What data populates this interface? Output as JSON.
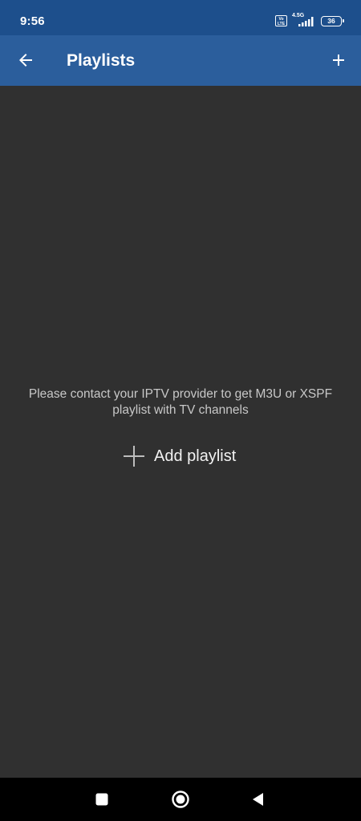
{
  "status_bar": {
    "time": "9:56",
    "volte": "Vo LTE",
    "network_type": "4.5G",
    "battery_level": "36",
    "icons": [
      "volte-icon",
      "signal-icon",
      "battery-icon"
    ]
  },
  "app_bar": {
    "title": "Playlists",
    "back_icon": "arrow-left-icon",
    "add_icon": "plus-icon",
    "background": "#2b5e9c",
    "status_background": "#1d4f8c"
  },
  "main": {
    "empty_message": "Please contact your IPTV provider to get M3U or XSPF playlist with TV channels",
    "add_playlist_label": "Add playlist",
    "add_playlist_icon": "plus-icon",
    "background": "#303030"
  },
  "nav_bar": {
    "items": [
      {
        "name": "recents",
        "icon": "square-icon"
      },
      {
        "name": "home",
        "icon": "circle-icon"
      },
      {
        "name": "back",
        "icon": "triangle-back-icon"
      }
    ]
  }
}
